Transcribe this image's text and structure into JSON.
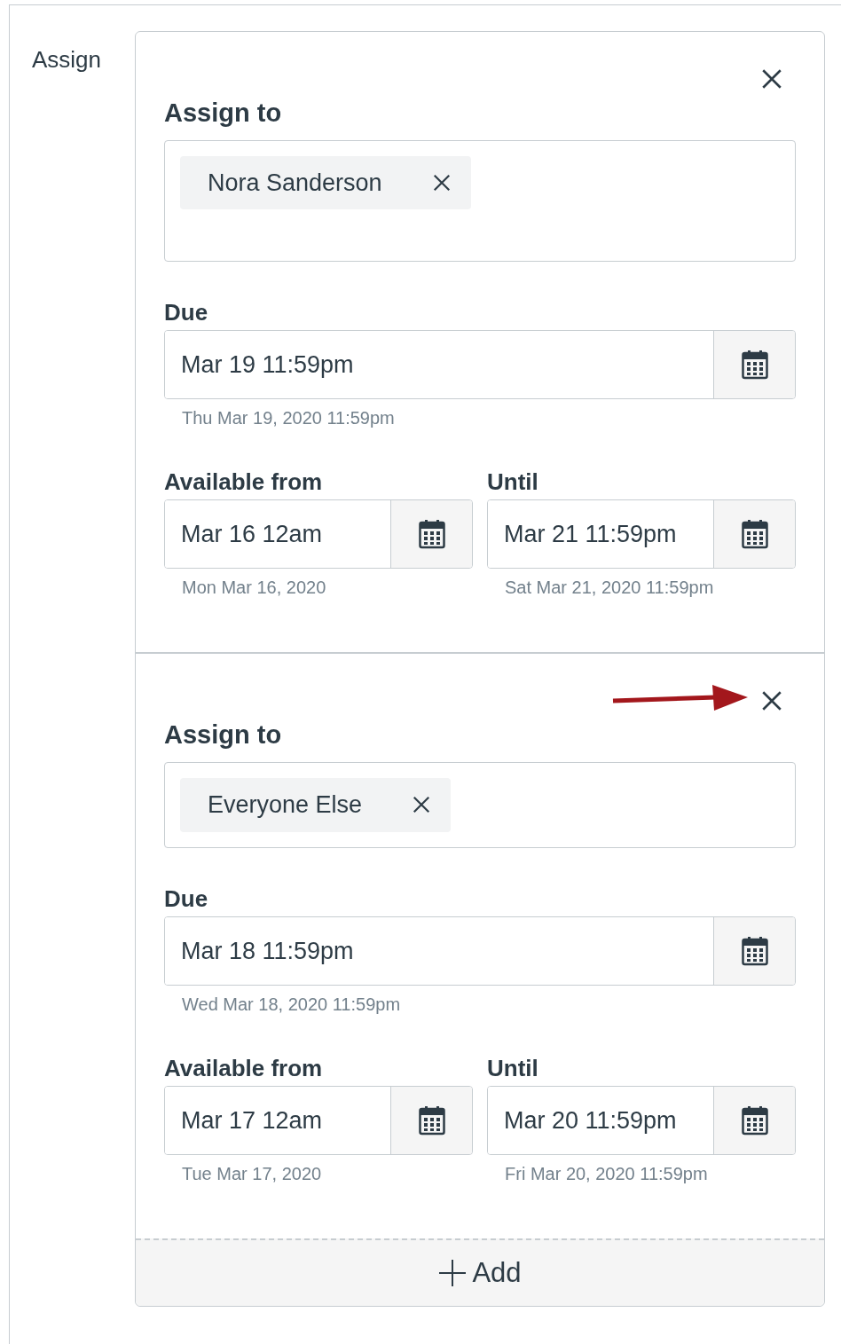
{
  "label": "Assign",
  "assignments": [
    {
      "annotated": false,
      "assign_to_label": "Assign to",
      "tokens": [
        "Nora Sanderson"
      ],
      "due": {
        "label": "Due",
        "value": "Mar 19 11:59pm",
        "hint": "Thu Mar 19, 2020 11:59pm"
      },
      "available_from": {
        "label": "Available from",
        "value": "Mar 16 12am",
        "hint": "Mon Mar 16, 2020"
      },
      "until": {
        "label": "Until",
        "value": "Mar 21 11:59pm",
        "hint": "Sat Mar 21, 2020 11:59pm"
      }
    },
    {
      "annotated": true,
      "assign_to_label": "Assign to",
      "tokens": [
        "Everyone Else"
      ],
      "due": {
        "label": "Due",
        "value": "Mar 18 11:59pm",
        "hint": "Wed Mar 18, 2020 11:59pm"
      },
      "available_from": {
        "label": "Available from",
        "value": "Mar 17 12am",
        "hint": "Tue Mar 17, 2020"
      },
      "until": {
        "label": "Until",
        "value": "Mar 20 11:59pm",
        "hint": "Fri Mar 20, 2020 11:59pm"
      }
    }
  ],
  "add_button": "Add"
}
